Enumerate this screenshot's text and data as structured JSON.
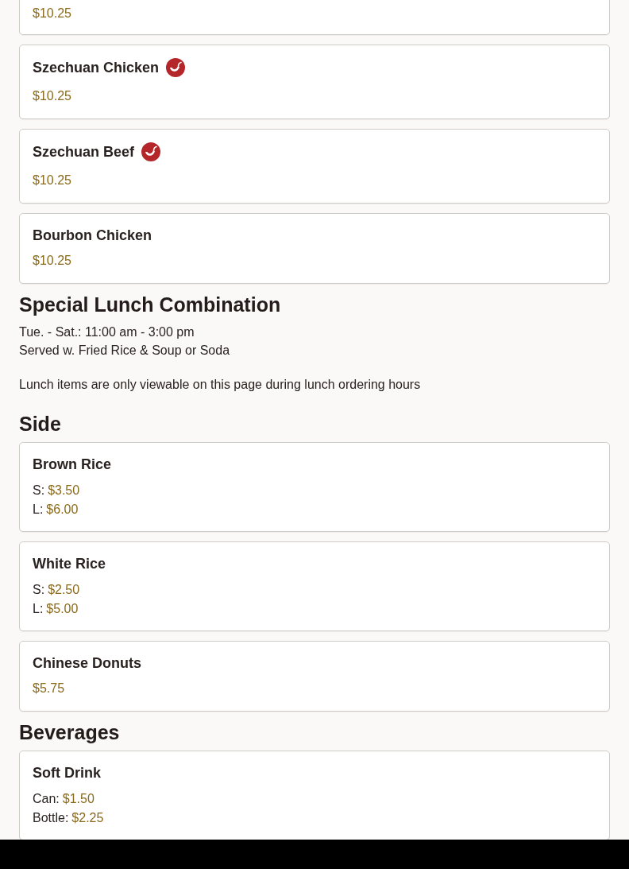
{
  "sections": [
    {
      "items": [
        {
          "kind": "single",
          "price": "$10.25"
        },
        {
          "name": "Szechuan Chicken",
          "spicy": true,
          "kind": "single",
          "price": "$10.25"
        },
        {
          "name": "Szechuan Beef",
          "spicy": true,
          "kind": "single",
          "price": "$10.25"
        },
        {
          "name": "Bourbon Chicken",
          "spicy": false,
          "kind": "single",
          "price": "$10.25"
        }
      ]
    },
    {
      "title": "Special Lunch Combination",
      "notes": [
        "Tue. - Sat.: 11:00 am - 3:00 pm",
        "Served w. Fried Rice & Soup or Soda"
      ],
      "message": "Lunch items are only viewable on this page during lunch ordering hours"
    },
    {
      "title": "Side",
      "items": [
        {
          "name": "Brown Rice",
          "spicy": false,
          "kind": "sizes",
          "prices": [
            {
              "label": "S:",
              "price": "$3.50"
            },
            {
              "label": "L:",
              "price": "$6.00"
            }
          ]
        },
        {
          "name": "White Rice",
          "spicy": false,
          "kind": "sizes",
          "prices": [
            {
              "label": "S:",
              "price": "$2.50"
            },
            {
              "label": "L:",
              "price": "$5.00"
            }
          ]
        },
        {
          "name": "Chinese Donuts",
          "spicy": false,
          "kind": "single",
          "price": "$5.75"
        }
      ]
    },
    {
      "title": "Beverages",
      "items": [
        {
          "name": "Soft Drink",
          "spicy": false,
          "kind": "sizes",
          "prices": [
            {
              "label": "Can:",
              "price": "$1.50"
            },
            {
              "label": "Bottle:",
              "price": "$2.25"
            }
          ]
        }
      ]
    }
  ]
}
